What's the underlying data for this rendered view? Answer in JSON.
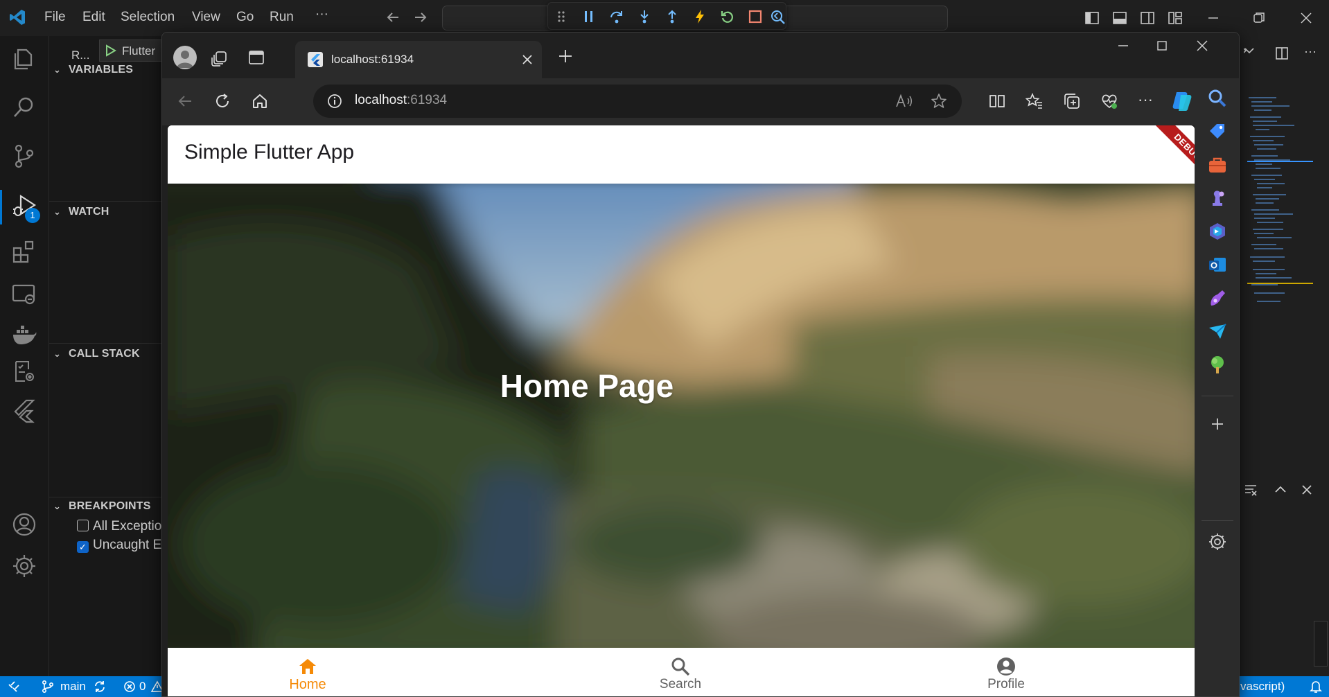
{
  "vscode": {
    "menu": [
      "File",
      "Edit",
      "Selection",
      "View",
      "Go",
      "Run",
      "···"
    ],
    "sidebar": {
      "run_label": "R...",
      "config_label": "Flutter",
      "sections": {
        "variables": "VARIABLES",
        "watch": "WATCH",
        "call_stack": "CALL STACK",
        "breakpoints": "BREAKPOINTS"
      },
      "breakpoints": [
        {
          "label": "All Exceptio",
          "checked": false
        },
        {
          "label": "Uncaught E",
          "checked": true
        }
      ]
    },
    "activity_badge": "1",
    "status_bar": {
      "branch": "main",
      "errors": "0",
      "right_text": "vascript)"
    },
    "colors": {
      "accent": "#0078d4",
      "status_bar": "#0078d4"
    }
  },
  "browser": {
    "tab_title": "localhost:61934",
    "url_host": "localhost",
    "url_port": ":61934"
  },
  "app": {
    "title": "Simple Flutter App",
    "debug_banner": "DEBUG",
    "page_heading": "Home Page",
    "nav": [
      {
        "label": "Home",
        "icon": "home-icon",
        "active": true
      },
      {
        "label": "Search",
        "icon": "search-icon",
        "active": false
      },
      {
        "label": "Profile",
        "icon": "profile-icon",
        "active": false
      }
    ],
    "colors": {
      "active_nav": "#f58a07",
      "inactive_nav": "#616161",
      "debug_banner": "#b71c1c"
    }
  }
}
